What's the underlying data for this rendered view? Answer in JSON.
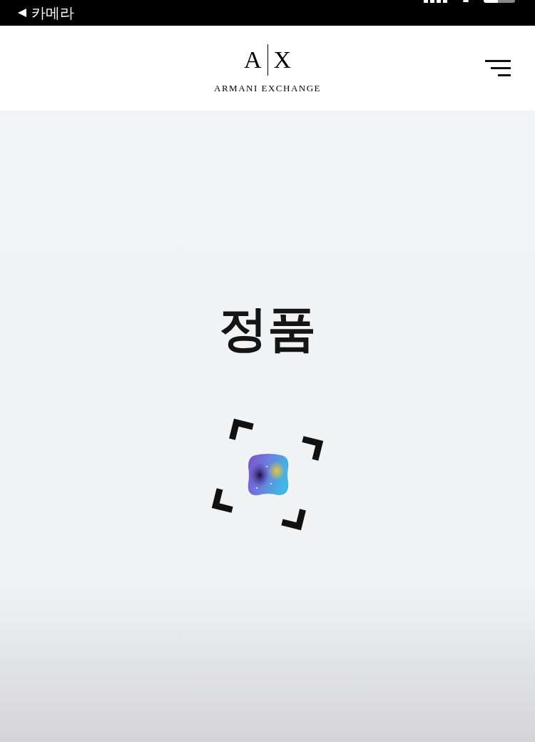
{
  "status_bar": {
    "back_label": "카메라"
  },
  "header": {
    "logo": {
      "left_letter": "A",
      "right_letter": "X",
      "wordmark": "ARMANI EXCHANGE"
    }
  },
  "main": {
    "title": "정품"
  }
}
